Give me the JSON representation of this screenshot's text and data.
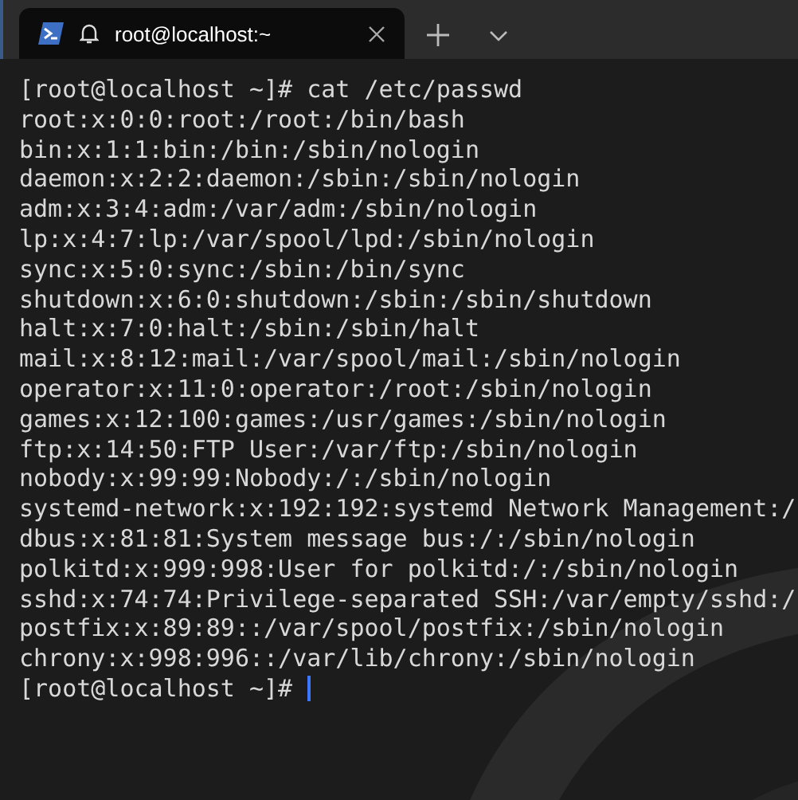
{
  "tabs": [
    {
      "title": "root@localhost:~",
      "selected": true
    }
  ],
  "terminal": {
    "lines": [
      "[root@localhost ~]# cat /etc/passwd",
      "root:x:0:0:root:/root:/bin/bash",
      "bin:x:1:1:bin:/bin:/sbin/nologin",
      "daemon:x:2:2:daemon:/sbin:/sbin/nologin",
      "adm:x:3:4:adm:/var/adm:/sbin/nologin",
      "lp:x:4:7:lp:/var/spool/lpd:/sbin/nologin",
      "sync:x:5:0:sync:/sbin:/bin/sync",
      "shutdown:x:6:0:shutdown:/sbin:/sbin/shutdown",
      "halt:x:7:0:halt:/sbin:/sbin/halt",
      "mail:x:8:12:mail:/var/spool/mail:/sbin/nologin",
      "operator:x:11:0:operator:/root:/sbin/nologin",
      "games:x:12:100:games:/usr/games:/sbin/nologin",
      "ftp:x:14:50:FTP User:/var/ftp:/sbin/nologin",
      "nobody:x:99:99:Nobody:/:/sbin/nologin",
      "systemd-network:x:192:192:systemd Network Management:/",
      "dbus:x:81:81:System message bus:/:/sbin/nologin",
      "polkitd:x:999:998:User for polkitd:/:/sbin/nologin",
      "sshd:x:74:74:Privilege-separated SSH:/var/empty/sshd:/",
      "postfix:x:89:89::/var/spool/postfix:/sbin/nologin",
      "chrony:x:998:996::/var/lib/chrony:/sbin/nologin"
    ],
    "prompt": "[root@localhost ~]#"
  }
}
